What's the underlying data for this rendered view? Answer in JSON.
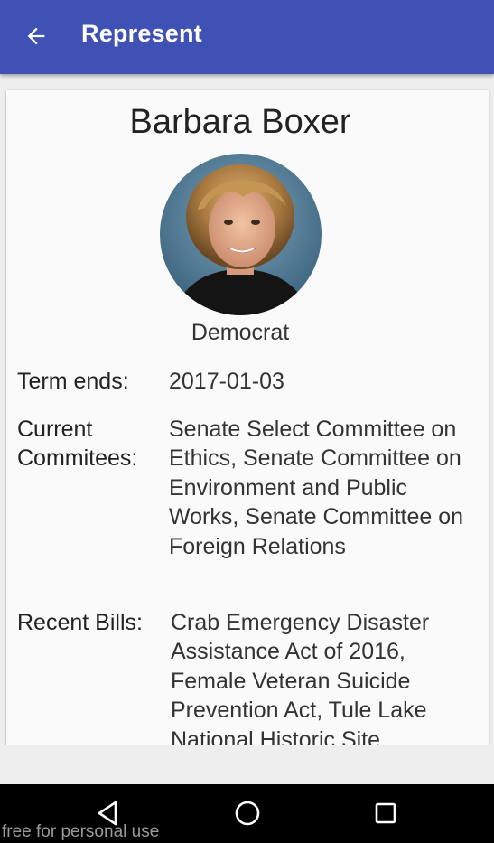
{
  "app_bar": {
    "title": "Represent",
    "back_icon": "arrow-back-icon",
    "color": "#3f51b5"
  },
  "profile": {
    "name": "Barbara Boxer",
    "party": "Democrat",
    "term_label": "Term ends:",
    "term_value": "2017-01-03",
    "committees_label": "Current\nCommitees:",
    "committees_value": "Senate Select Committee on Ethics, Senate Committee on Environment and Public Works, Senate Committee on Foreign Relations",
    "bills_label": "Recent Bills:",
    "bills_value": "Crab Emergency Disaster Assistance Act of 2016, Female Veteran Suicide Prevention Act, Tule Lake National Historic Site"
  },
  "nav_bar": {
    "back_icon": "triangle-back-icon",
    "home_icon": "circle-home-icon",
    "recents_icon": "square-recents-icon"
  },
  "watermark": "free for personal use"
}
